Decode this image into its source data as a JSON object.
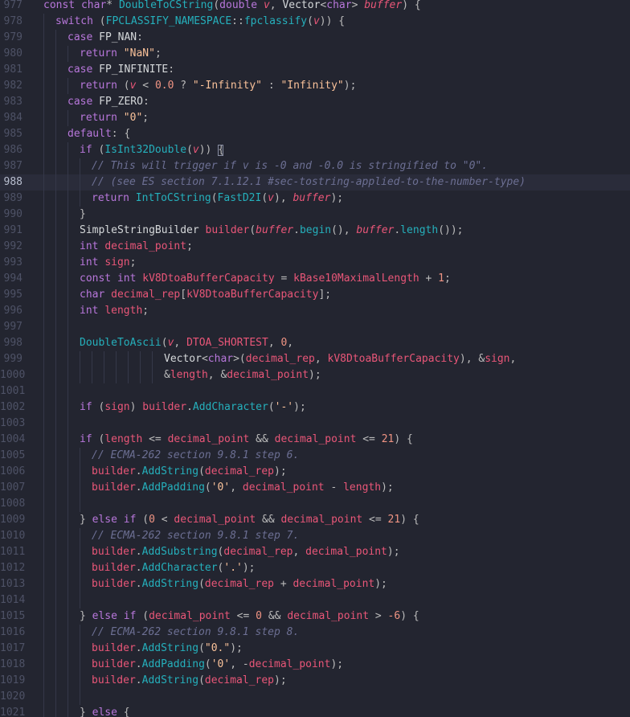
{
  "editor": {
    "active_line": "988",
    "colors": {
      "background": "#232530",
      "current_line": "#2a2c3a",
      "keyword": "#b877db",
      "function": "#25b0bc",
      "string": "#fac29a",
      "number": "#f09483",
      "variable": "#e95678",
      "comment": "#6c6f93",
      "text": "#d5d8da",
      "punctuation": "#bbbbbb"
    },
    "lines": [
      {
        "n": "977",
        "indent": 0,
        "tokens": [
          [
            "k",
            "const "
          ],
          [
            "k",
            "char"
          ],
          [
            "o",
            "* "
          ],
          [
            "f",
            "DoubleToCString"
          ],
          [
            "p",
            "("
          ],
          [
            "k",
            "double "
          ],
          [
            "pi",
            "v"
          ],
          [
            "p",
            ", "
          ],
          [
            "t",
            "Vector"
          ],
          [
            "p",
            "<"
          ],
          [
            "k",
            "char"
          ],
          [
            "p",
            "> "
          ],
          [
            "pi",
            "buffer"
          ],
          [
            "p",
            ") {"
          ]
        ]
      },
      {
        "n": "978",
        "indent": 1,
        "tokens": [
          [
            "k",
            "switch "
          ],
          [
            "p",
            "("
          ],
          [
            "f",
            "FPCLASSIFY_NAMESPACE"
          ],
          [
            "p",
            "::"
          ],
          [
            "f",
            "fpclassify"
          ],
          [
            "p",
            "("
          ],
          [
            "pi",
            "v"
          ],
          [
            "p",
            ")) {"
          ]
        ]
      },
      {
        "n": "979",
        "indent": 2,
        "tokens": [
          [
            "k",
            "case "
          ],
          [
            "t",
            "FP_NAN"
          ],
          [
            "p",
            ":"
          ]
        ]
      },
      {
        "n": "980",
        "indent": 3,
        "tokens": [
          [
            "k",
            "return "
          ],
          [
            "s",
            "\"NaN\""
          ],
          [
            "p",
            ";"
          ]
        ]
      },
      {
        "n": "981",
        "indent": 2,
        "tokens": [
          [
            "k",
            "case "
          ],
          [
            "t",
            "FP_INFINITE"
          ],
          [
            "p",
            ":"
          ]
        ]
      },
      {
        "n": "982",
        "indent": 3,
        "tokens": [
          [
            "k",
            "return "
          ],
          [
            "p",
            "("
          ],
          [
            "pi",
            "v"
          ],
          [
            "o",
            " < "
          ],
          [
            "m",
            "0.0"
          ],
          [
            "o",
            " ? "
          ],
          [
            "s",
            "\"-Infinity\""
          ],
          [
            "o",
            " : "
          ],
          [
            "s",
            "\"Infinity\""
          ],
          [
            "p",
            ");"
          ]
        ]
      },
      {
        "n": "983",
        "indent": 2,
        "tokens": [
          [
            "k",
            "case "
          ],
          [
            "t",
            "FP_ZERO"
          ],
          [
            "p",
            ":"
          ]
        ]
      },
      {
        "n": "984",
        "indent": 3,
        "tokens": [
          [
            "k",
            "return "
          ],
          [
            "s",
            "\"0\""
          ],
          [
            "p",
            ";"
          ]
        ]
      },
      {
        "n": "985",
        "indent": 2,
        "tokens": [
          [
            "k",
            "default"
          ],
          [
            "p",
            ": {"
          ]
        ]
      },
      {
        "n": "986",
        "indent": 3,
        "cursor": 1,
        "tokens": [
          [
            "k",
            "if "
          ],
          [
            "p",
            "("
          ],
          [
            "f",
            "IsInt32Double"
          ],
          [
            "p",
            "("
          ],
          [
            "pi",
            "v"
          ],
          [
            "p",
            ")) {"
          ]
        ]
      },
      {
        "n": "987",
        "indent": 4,
        "tokens": [
          [
            "c",
            "// This will trigger if v is -0 and -0.0 is stringified to \"0\"."
          ]
        ]
      },
      {
        "n": "988",
        "indent": 4,
        "tokens": [
          [
            "c",
            "// (see ES section 7.1.12.1 #sec-tostring-applied-to-the-number-type)"
          ]
        ]
      },
      {
        "n": "989",
        "indent": 4,
        "tokens": [
          [
            "k",
            "return "
          ],
          [
            "f",
            "IntToCString"
          ],
          [
            "p",
            "("
          ],
          [
            "f",
            "FastD2I"
          ],
          [
            "p",
            "("
          ],
          [
            "pi",
            "v"
          ],
          [
            "p",
            "), "
          ],
          [
            "pi",
            "buffer"
          ],
          [
            "p",
            ");"
          ]
        ]
      },
      {
        "n": "990",
        "indent": 3,
        "tokens": [
          [
            "p",
            "}"
          ]
        ]
      },
      {
        "n": "991",
        "indent": 3,
        "tokens": [
          [
            "t",
            "SimpleStringBuilder "
          ],
          [
            "v",
            "builder"
          ],
          [
            "p",
            "("
          ],
          [
            "pi",
            "buffer"
          ],
          [
            "p",
            "."
          ],
          [
            "f",
            "begin"
          ],
          [
            "p",
            "(), "
          ],
          [
            "pi",
            "buffer"
          ],
          [
            "p",
            "."
          ],
          [
            "f",
            "length"
          ],
          [
            "p",
            "());"
          ]
        ]
      },
      {
        "n": "992",
        "indent": 3,
        "tokens": [
          [
            "k",
            "int "
          ],
          [
            "v",
            "decimal_point"
          ],
          [
            "p",
            ";"
          ]
        ]
      },
      {
        "n": "993",
        "indent": 3,
        "tokens": [
          [
            "k",
            "int "
          ],
          [
            "v",
            "sign"
          ],
          [
            "p",
            ";"
          ]
        ]
      },
      {
        "n": "994",
        "indent": 3,
        "tokens": [
          [
            "k",
            "const int "
          ],
          [
            "v",
            "kV8DtoaBufferCapacity"
          ],
          [
            "o",
            " = "
          ],
          [
            "v",
            "kBase10MaximalLength"
          ],
          [
            "o",
            " + "
          ],
          [
            "m",
            "1"
          ],
          [
            "p",
            ";"
          ]
        ]
      },
      {
        "n": "995",
        "indent": 3,
        "tokens": [
          [
            "k",
            "char "
          ],
          [
            "v",
            "decimal_rep"
          ],
          [
            "p",
            "["
          ],
          [
            "v",
            "kV8DtoaBufferCapacity"
          ],
          [
            "p",
            "];"
          ]
        ]
      },
      {
        "n": "996",
        "indent": 3,
        "tokens": [
          [
            "k",
            "int "
          ],
          [
            "v",
            "length"
          ],
          [
            "p",
            ";"
          ]
        ]
      },
      {
        "n": "997",
        "indent": 3,
        "tokens": []
      },
      {
        "n": "998",
        "indent": 3,
        "tokens": [
          [
            "f",
            "DoubleToAscii"
          ],
          [
            "p",
            "("
          ],
          [
            "pi",
            "v"
          ],
          [
            "p",
            ", "
          ],
          [
            "v",
            "DTOA_SHORTEST"
          ],
          [
            "p",
            ", "
          ],
          [
            "m",
            "0"
          ],
          [
            "p",
            ","
          ]
        ]
      },
      {
        "n": "999",
        "indent": 10,
        "tokens": [
          [
            "t",
            "Vector"
          ],
          [
            "p",
            "<"
          ],
          [
            "k",
            "char"
          ],
          [
            "p",
            ">("
          ],
          [
            "v",
            "decimal_rep"
          ],
          [
            "p",
            ", "
          ],
          [
            "v",
            "kV8DtoaBufferCapacity"
          ],
          [
            "p",
            "), &"
          ],
          [
            "v",
            "sign"
          ],
          [
            "p",
            ","
          ]
        ]
      },
      {
        "n": "1000",
        "indent": 10,
        "tokens": [
          [
            "p",
            "&"
          ],
          [
            "v",
            "length"
          ],
          [
            "p",
            ", &"
          ],
          [
            "v",
            "decimal_point"
          ],
          [
            "p",
            ");"
          ]
        ]
      },
      {
        "n": "1001",
        "indent": 3,
        "tokens": []
      },
      {
        "n": "1002",
        "indent": 3,
        "tokens": [
          [
            "k",
            "if "
          ],
          [
            "p",
            "("
          ],
          [
            "v",
            "sign"
          ],
          [
            "p",
            ") "
          ],
          [
            "v",
            "builder"
          ],
          [
            "p",
            "."
          ],
          [
            "f",
            "AddCharacter"
          ],
          [
            "p",
            "("
          ],
          [
            "s",
            "'-'"
          ],
          [
            "p",
            ");"
          ]
        ]
      },
      {
        "n": "1003",
        "indent": 3,
        "tokens": []
      },
      {
        "n": "1004",
        "indent": 3,
        "tokens": [
          [
            "k",
            "if "
          ],
          [
            "p",
            "("
          ],
          [
            "v",
            "length"
          ],
          [
            "o",
            " <= "
          ],
          [
            "v",
            "decimal_point"
          ],
          [
            "o",
            " && "
          ],
          [
            "v",
            "decimal_point"
          ],
          [
            "o",
            " <= "
          ],
          [
            "m",
            "21"
          ],
          [
            "p",
            ") {"
          ]
        ]
      },
      {
        "n": "1005",
        "indent": 4,
        "tokens": [
          [
            "c",
            "// ECMA-262 section 9.8.1 step 6."
          ]
        ]
      },
      {
        "n": "1006",
        "indent": 4,
        "tokens": [
          [
            "v",
            "builder"
          ],
          [
            "p",
            "."
          ],
          [
            "f",
            "AddString"
          ],
          [
            "p",
            "("
          ],
          [
            "v",
            "decimal_rep"
          ],
          [
            "p",
            ");"
          ]
        ]
      },
      {
        "n": "1007",
        "indent": 4,
        "tokens": [
          [
            "v",
            "builder"
          ],
          [
            "p",
            "."
          ],
          [
            "f",
            "AddPadding"
          ],
          [
            "p",
            "("
          ],
          [
            "s",
            "'0'"
          ],
          [
            "p",
            ", "
          ],
          [
            "v",
            "decimal_point"
          ],
          [
            "o",
            " - "
          ],
          [
            "v",
            "length"
          ],
          [
            "p",
            ");"
          ]
        ]
      },
      {
        "n": "1008",
        "indent": 4,
        "tokens": []
      },
      {
        "n": "1009",
        "indent": 3,
        "tokens": [
          [
            "p",
            "} "
          ],
          [
            "k",
            "else if "
          ],
          [
            "p",
            "("
          ],
          [
            "m",
            "0"
          ],
          [
            "o",
            " < "
          ],
          [
            "v",
            "decimal_point"
          ],
          [
            "o",
            " && "
          ],
          [
            "v",
            "decimal_point"
          ],
          [
            "o",
            " <= "
          ],
          [
            "m",
            "21"
          ],
          [
            "p",
            ") {"
          ]
        ]
      },
      {
        "n": "1010",
        "indent": 4,
        "tokens": [
          [
            "c",
            "// ECMA-262 section 9.8.1 step 7."
          ]
        ]
      },
      {
        "n": "1011",
        "indent": 4,
        "tokens": [
          [
            "v",
            "builder"
          ],
          [
            "p",
            "."
          ],
          [
            "f",
            "AddSubstring"
          ],
          [
            "p",
            "("
          ],
          [
            "v",
            "decimal_rep"
          ],
          [
            "p",
            ", "
          ],
          [
            "v",
            "decimal_point"
          ],
          [
            "p",
            ");"
          ]
        ]
      },
      {
        "n": "1012",
        "indent": 4,
        "tokens": [
          [
            "v",
            "builder"
          ],
          [
            "p",
            "."
          ],
          [
            "f",
            "AddCharacter"
          ],
          [
            "p",
            "("
          ],
          [
            "s",
            "'.'"
          ],
          [
            "p",
            ");"
          ]
        ]
      },
      {
        "n": "1013",
        "indent": 4,
        "tokens": [
          [
            "v",
            "builder"
          ],
          [
            "p",
            "."
          ],
          [
            "f",
            "AddString"
          ],
          [
            "p",
            "("
          ],
          [
            "v",
            "decimal_rep"
          ],
          [
            "o",
            " + "
          ],
          [
            "v",
            "decimal_point"
          ],
          [
            "p",
            ");"
          ]
        ]
      },
      {
        "n": "1014",
        "indent": 4,
        "tokens": []
      },
      {
        "n": "1015",
        "indent": 3,
        "tokens": [
          [
            "p",
            "} "
          ],
          [
            "k",
            "else if "
          ],
          [
            "p",
            "("
          ],
          [
            "v",
            "decimal_point"
          ],
          [
            "o",
            " <= "
          ],
          [
            "m",
            "0"
          ],
          [
            "o",
            " && "
          ],
          [
            "v",
            "decimal_point"
          ],
          [
            "o",
            " > "
          ],
          [
            "m",
            "-6"
          ],
          [
            "p",
            ") {"
          ]
        ]
      },
      {
        "n": "1016",
        "indent": 4,
        "tokens": [
          [
            "c",
            "// ECMA-262 section 9.8.1 step 8."
          ]
        ]
      },
      {
        "n": "1017",
        "indent": 4,
        "tokens": [
          [
            "v",
            "builder"
          ],
          [
            "p",
            "."
          ],
          [
            "f",
            "AddString"
          ],
          [
            "p",
            "("
          ],
          [
            "s",
            "\"0.\""
          ],
          [
            "p",
            ");"
          ]
        ]
      },
      {
        "n": "1018",
        "indent": 4,
        "tokens": [
          [
            "v",
            "builder"
          ],
          [
            "p",
            "."
          ],
          [
            "f",
            "AddPadding"
          ],
          [
            "p",
            "("
          ],
          [
            "s",
            "'0'"
          ],
          [
            "p",
            ", "
          ],
          [
            "o",
            "-"
          ],
          [
            "v",
            "decimal_point"
          ],
          [
            "p",
            ");"
          ]
        ]
      },
      {
        "n": "1019",
        "indent": 4,
        "tokens": [
          [
            "v",
            "builder"
          ],
          [
            "p",
            "."
          ],
          [
            "f",
            "AddString"
          ],
          [
            "p",
            "("
          ],
          [
            "v",
            "decimal_rep"
          ],
          [
            "p",
            ");"
          ]
        ]
      },
      {
        "n": "1020",
        "indent": 4,
        "tokens": []
      },
      {
        "n": "1021",
        "indent": 3,
        "tokens": [
          [
            "p",
            "} "
          ],
          [
            "k",
            "else "
          ],
          [
            "p",
            "{"
          ]
        ]
      }
    ]
  }
}
